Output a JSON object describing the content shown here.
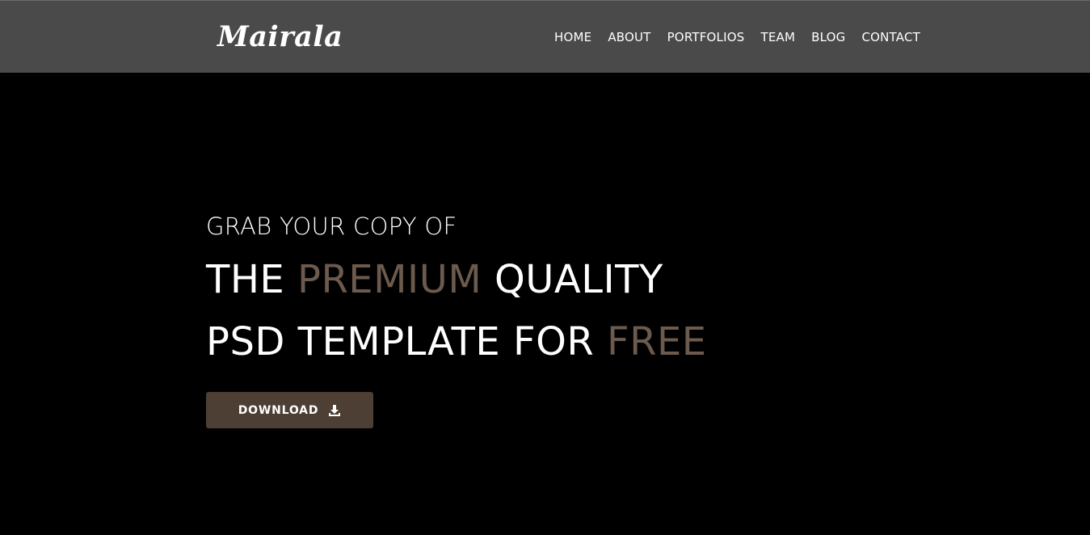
{
  "brand": {
    "logo_text": "Mairala"
  },
  "nav": {
    "items": [
      {
        "label": "HOME"
      },
      {
        "label": "ABOUT"
      },
      {
        "label": "PORTFOLIOS"
      },
      {
        "label": "TEAM"
      },
      {
        "label": "BLOG"
      },
      {
        "label": "CONTACT"
      }
    ]
  },
  "hero": {
    "subtitle": "GRAB YOUR COPY OF",
    "line1": {
      "part1": "THE ",
      "accent": "PREMIUM",
      "part2": " QUALITY"
    },
    "line2": {
      "part1": "PSD TEMPLATE FOR ",
      "accent": "FREE"
    },
    "button_label": "DOWNLOAD",
    "button_icon": "download-icon"
  },
  "colors": {
    "navbar_bg": "#4a4a4a",
    "page_bg": "#000000",
    "accent": "#6b5a4d",
    "button_bg": "#4d3f33"
  }
}
